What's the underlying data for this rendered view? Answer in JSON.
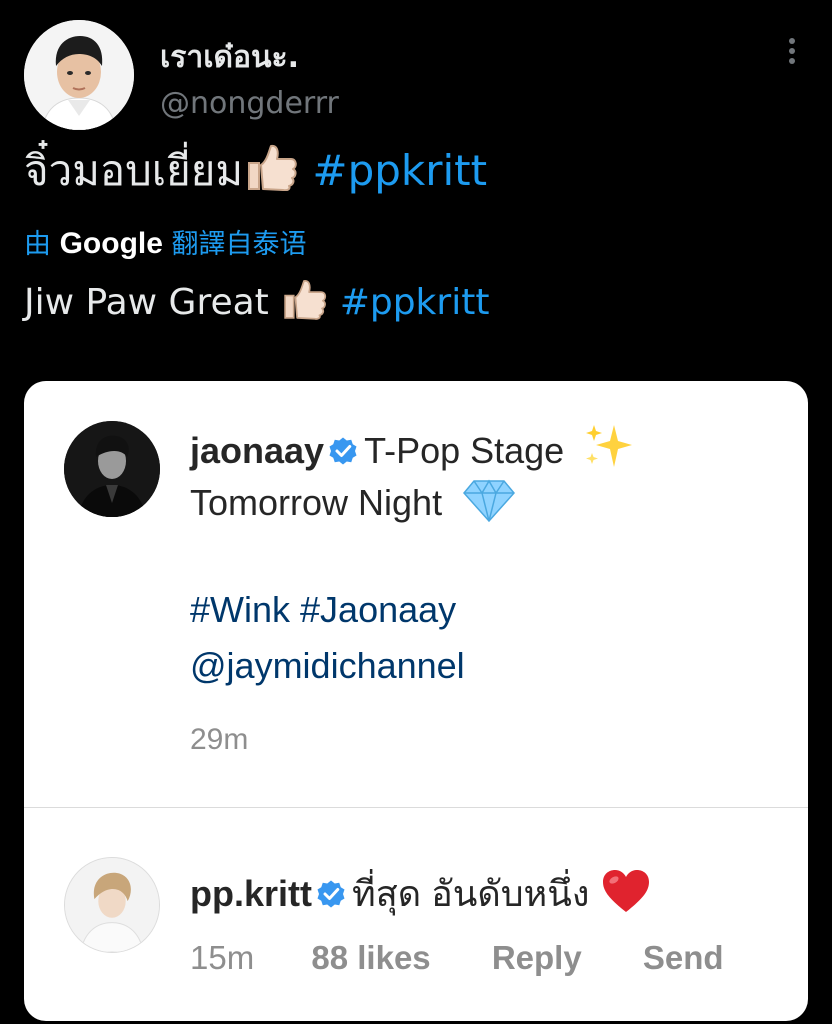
{
  "tweet": {
    "display_name": "เราเด๋อนะ.",
    "handle": "@nongderrr",
    "text": "จิ๋วมอบเยี่ยม",
    "hashtag": "#ppkritt",
    "translate_prefix": "由",
    "translate_brand": "Google",
    "translate_suffix": "翻譯自泰语",
    "translated_text": "Jiw Paw Great",
    "translated_hashtag": "#ppkritt",
    "emoji_icon": "thumbs-up-light-skin-icon"
  },
  "ig_card": {
    "post": {
      "username": "jaonaay",
      "caption_line1": "T-Pop Stage",
      "caption_line2": "Tomorrow Night",
      "hashtags": "#Wink #Jaonaay",
      "mention": "@jaymidichannel",
      "time": "29m"
    },
    "comment": {
      "username": "pp.kritt",
      "text": "ที่สุด อันดับหนึ่ง",
      "time": "15m",
      "likes": "88 likes",
      "reply": "Reply",
      "send": "Send"
    }
  },
  "colors": {
    "background": "#000000",
    "link_blue": "#1d9bf0",
    "ig_link": "#00376b",
    "verified_blue": "#3897f0",
    "heart_red": "#e0232e"
  }
}
